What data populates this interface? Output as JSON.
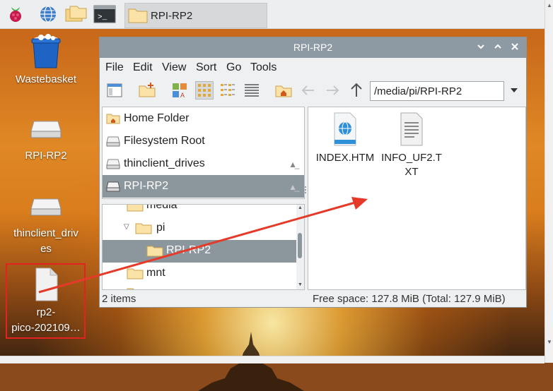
{
  "taskbar": {
    "launcher_icons": [
      "raspberry-menu-icon",
      "web-browser-icon",
      "file-manager-icon",
      "terminal-icon"
    ],
    "task_label": "RPI-RP2"
  },
  "desktop": {
    "icons": [
      {
        "name": "wastebasket",
        "label": "Wastebasket",
        "icon": "trash-icon"
      },
      {
        "name": "rpi-rp2",
        "label": "RPI-RP2",
        "icon": "drive-icon"
      },
      {
        "name": "thinclient-drives",
        "label_line1": "thinclient_driv",
        "label_line2": "es",
        "icon": "drive-icon"
      },
      {
        "name": "rp2-pico-file",
        "label_line1": "rp2-",
        "label_line2": "pico-202109…",
        "icon": "file-icon"
      }
    ]
  },
  "window": {
    "title": "RPI-RP2",
    "controls": [
      "minimize",
      "maximize",
      "close"
    ],
    "menu": [
      "File",
      "Edit",
      "View",
      "Sort",
      "Go",
      "Tools"
    ],
    "path": "/media/pi/RPI-RP2",
    "places": [
      {
        "label": "Home Folder",
        "icon": "home-folder-icon",
        "selected": false,
        "eject": false
      },
      {
        "label": "Filesystem Root",
        "icon": "drive-icon",
        "selected": false,
        "eject": false
      },
      {
        "label": "thinclient_drives",
        "icon": "drive-icon",
        "selected": false,
        "eject": true
      },
      {
        "label": "RPI-RP2",
        "icon": "drive-icon",
        "selected": true,
        "eject": true
      }
    ],
    "tree": [
      {
        "label": "media",
        "selected": false
      },
      {
        "label": "pi",
        "selected": false,
        "expanded": true
      },
      {
        "label": "RPI-RP2",
        "selected": true
      },
      {
        "label": "mnt",
        "selected": false
      },
      {
        "label": "",
        "selected": false
      }
    ],
    "files": [
      {
        "label_line1": "INDEX.HTM",
        "label_line2": "",
        "icon": "html-file-icon"
      },
      {
        "label_line1": "INFO_UF2.T",
        "label_line2": "XT",
        "icon": "text-file-icon"
      }
    ],
    "status": {
      "items": "2 items",
      "free_space": "Free space: 127.8 MiB (Total: 127.9 MiB)"
    }
  },
  "colors": {
    "selection": "#8c969d",
    "titlebar": "#8e9aa3",
    "highlight_box": "#e52222",
    "arrow": "#e53a2a"
  }
}
